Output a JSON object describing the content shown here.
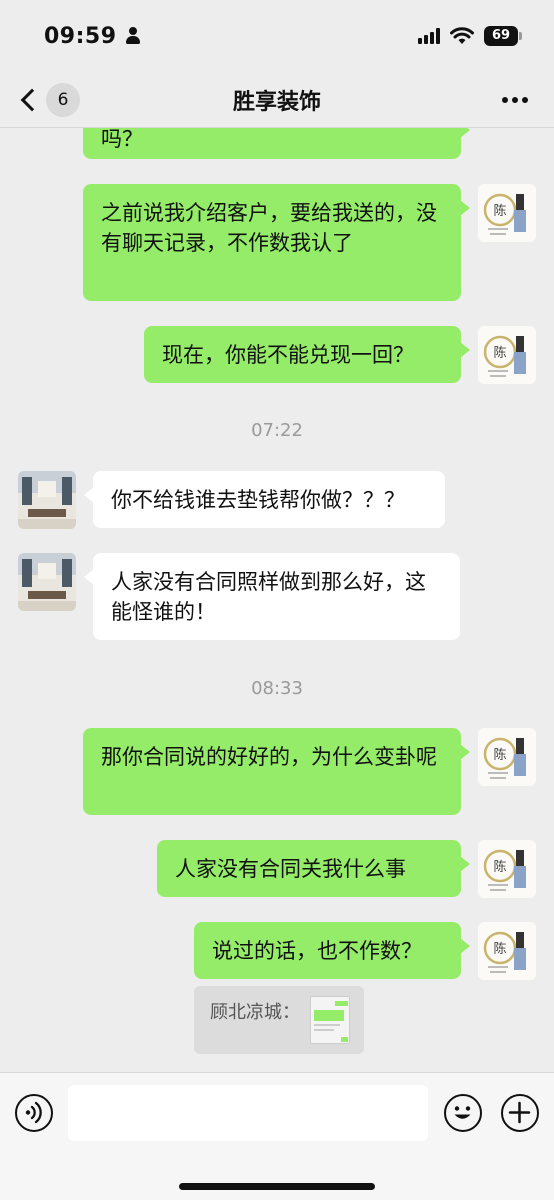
{
  "status_bar": {
    "time": "09:59",
    "battery": "69"
  },
  "nav": {
    "unread_count": "6",
    "title": "胜享装饰"
  },
  "messages": {
    "m0": "吗？",
    "m1": "之前说我介绍客户，要给我送的，没有聊天记录，不作数我认了",
    "m2": "现在，你能不能兑现一回？",
    "t1": "07:22",
    "m3": "你不给钱谁去垫钱帮你做？？？",
    "m4": "人家没有合同照样做到那么好，这能怪谁的！",
    "t2": "08:33",
    "m5": "那你合同说的好好的，为什么变卦呢",
    "m6": "人家没有合同关我什么事",
    "m7": "说过的话，也不作数？",
    "quote_name": "顾北凉城："
  },
  "self_avatar": {
    "seal_char": "陈"
  },
  "colors": {
    "outgoing_bubble": "#95ec69",
    "incoming_bubble": "#ffffff",
    "background": "#ededed"
  },
  "icons": [
    "back-chevron-icon",
    "more-icon",
    "voice-icon",
    "emoji-icon",
    "plus-icon"
  ]
}
